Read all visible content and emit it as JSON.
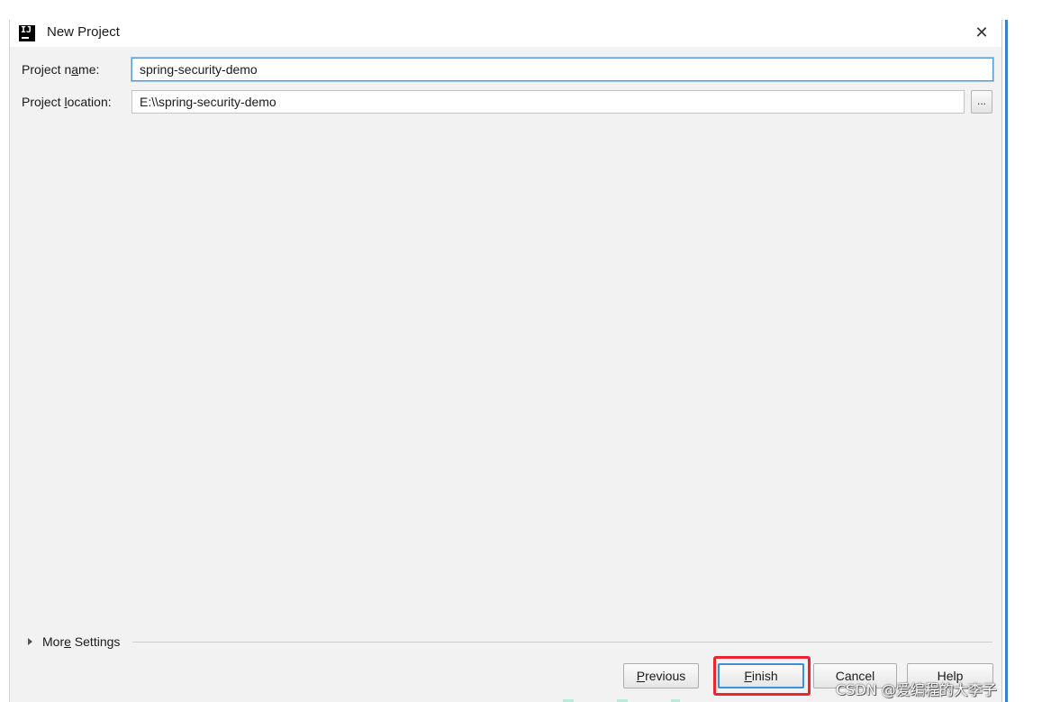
{
  "window": {
    "title": "New Project",
    "app_icon_text": "IJ"
  },
  "form": {
    "project_name_label_pre": "Project n",
    "project_name_label_accel": "a",
    "project_name_label_post": "me:",
    "project_name_value": "spring-security-demo",
    "project_location_label_pre": "Project ",
    "project_location_label_accel": "l",
    "project_location_label_post": "ocation:",
    "project_location_value": "E:\\\\spring-security-demo",
    "browse_label": "..."
  },
  "more_settings": {
    "label_pre": "Mor",
    "label_accel": "e",
    "label_post": " Settings"
  },
  "buttons": {
    "previous_accel": "P",
    "previous_rest": "revious",
    "finish_accel": "F",
    "finish_rest": "inish",
    "cancel": "Cancel",
    "help": "Help"
  },
  "watermark": "CSDN @爱编程的大李子",
  "colors": {
    "focus_border": "#5b9bd5",
    "highlight": "#e8262b",
    "dialog_bg": "#f2f2f2"
  }
}
